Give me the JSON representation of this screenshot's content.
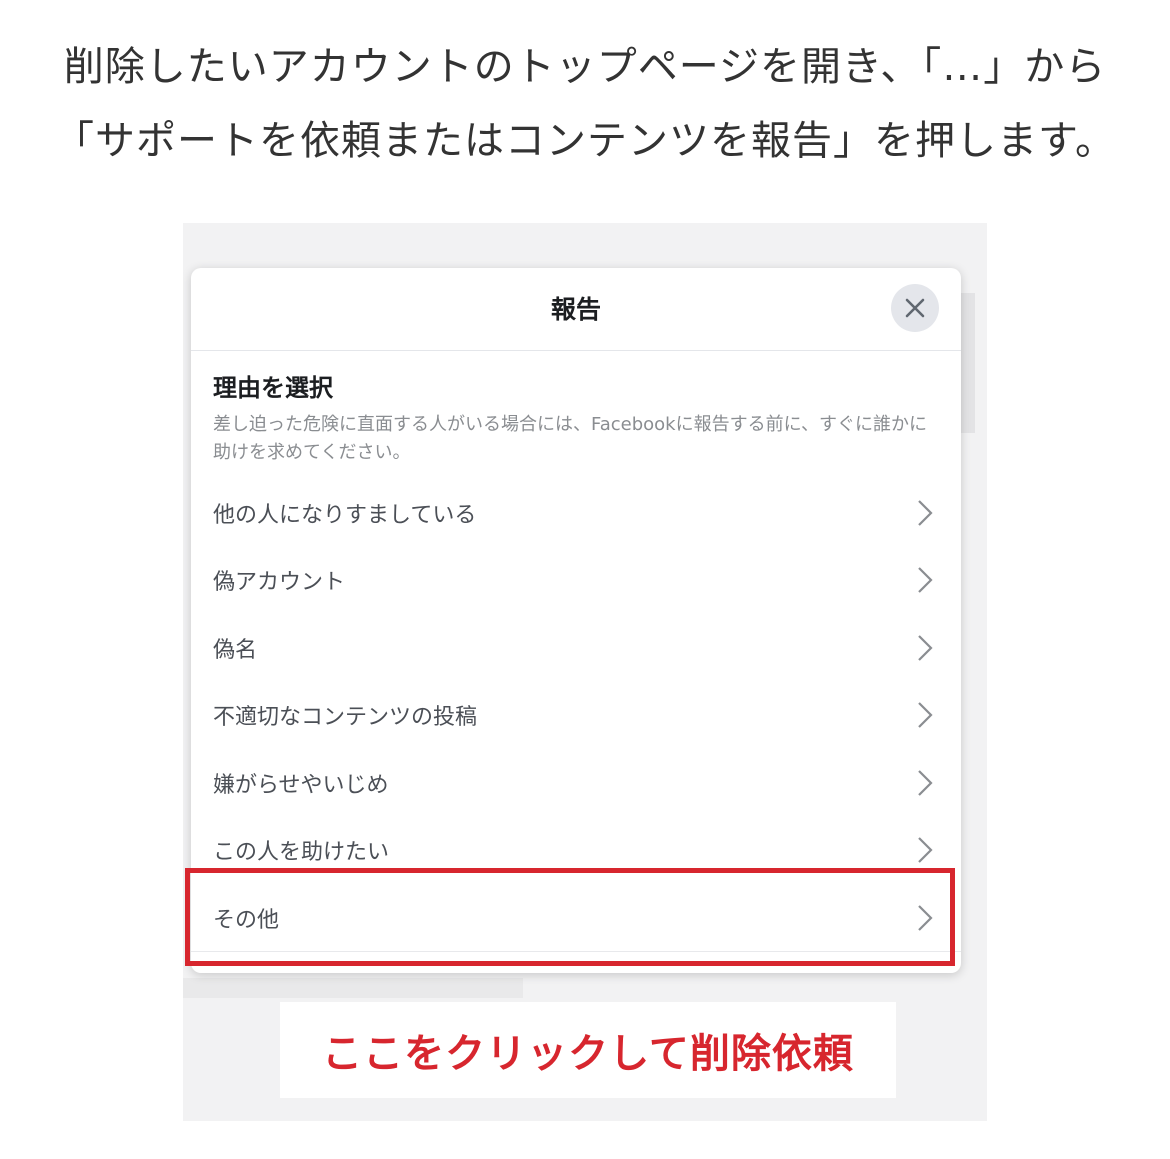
{
  "instruction": {
    "line1": "削除したいアカウントのトップページを開き、「…」から",
    "line2": "「サポートを依頼またはコンテンツを報告」を押します。"
  },
  "dialog": {
    "title": "報告",
    "close_icon": "close-icon",
    "section_title": "理由を選択",
    "description": "差し迫った危険に直面する人がいる場合には、Facebookに報告する前に、すぐに誰かに助けを求めてください。",
    "reasons": [
      {
        "label": "他の人になりすましている"
      },
      {
        "label": "偽アカウント"
      },
      {
        "label": "偽名"
      },
      {
        "label": "不適切なコンテンツの投稿"
      },
      {
        "label": "嫌がらせやいじめ"
      },
      {
        "label": "この人を助けたい"
      },
      {
        "label": "その他"
      }
    ]
  },
  "annotation": {
    "caption": "ここをクリックして削除依頼",
    "highlight_color": "#d7262e"
  }
}
